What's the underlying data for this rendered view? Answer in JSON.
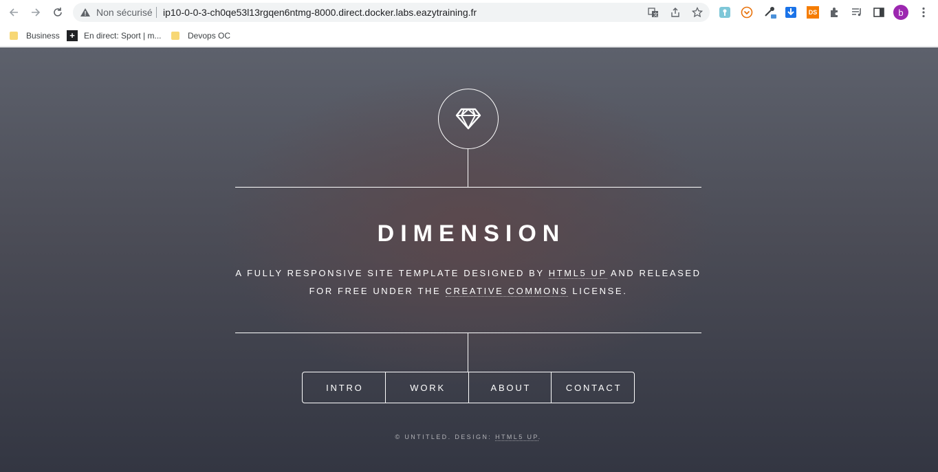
{
  "browser": {
    "security_label": "Non sécurisé",
    "url": "ip10-0-0-3-ch0qe53l13rgqen6ntmg-8000.direct.docker.labs.eazytraining.fr",
    "profile_initial": "b",
    "extensions": [
      "download-icon",
      "ds-extension-icon"
    ],
    "ext_ds_label": "DS"
  },
  "bookmarks": [
    {
      "label": "Business",
      "icon": "folder-icon"
    },
    {
      "label": "En direct: Sport | m...",
      "icon": "plus-icon"
    },
    {
      "label": "Devops OC",
      "icon": "folder-icon"
    }
  ],
  "site": {
    "title": "DIMENSION",
    "subtitle": {
      "line1_pre": "A FULLY RESPONSIVE SITE TEMPLATE DESIGNED BY",
      "line1_link": "HTML5 UP",
      "line1_post": "AND RELEASED",
      "line2_pre": "FOR FREE UNDER THE",
      "line2_link": "CREATIVE COMMONS",
      "line2_post": "LICENSE."
    },
    "nav": [
      "INTRO",
      "WORK",
      "ABOUT",
      "CONTACT"
    ],
    "footer": {
      "text": "© UNTITLED. DESIGN:",
      "link": "HTML5 UP",
      "end": "."
    },
    "colors": {
      "text": "#ffffff",
      "bg_top": "#5d616c",
      "bg_bottom": "#333642",
      "glow": "#5c484c"
    }
  }
}
